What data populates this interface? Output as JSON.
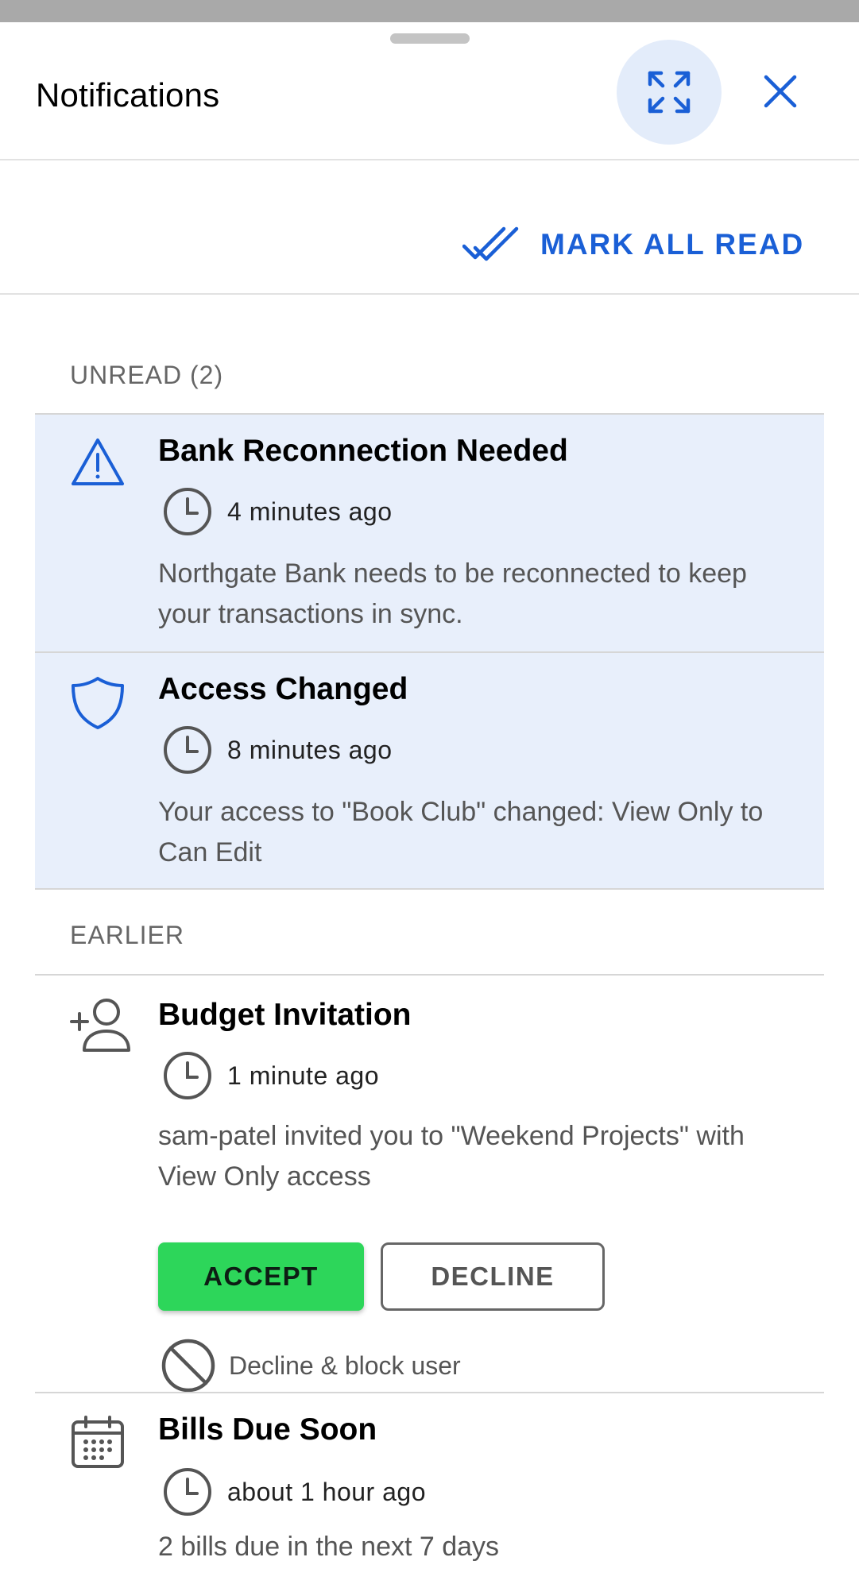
{
  "header": {
    "title": "Notifications",
    "expand_icon": "expand-arrows-icon",
    "close_icon": "close-icon"
  },
  "toolbar": {
    "mark_all_read_label": "MARK ALL READ",
    "mark_all_read_icon": "double-check-icon"
  },
  "sections": {
    "unread_label": "UNREAD (2)",
    "earlier_label": "EARLIER"
  },
  "notifications": [
    {
      "icon": "warning-icon",
      "title": "Bank Reconnection Needed",
      "time": "4 minutes ago",
      "body": "Northgate Bank needs to be reconnected to keep your transactions in sync.",
      "unread": true
    },
    {
      "icon": "shield-icon",
      "title": "Access Changed",
      "time": "8 minutes ago",
      "body": "Your access to \"Book Club\" changed: View Only to Can Edit",
      "unread": true
    },
    {
      "icon": "add-user-icon",
      "title": "Budget Invitation",
      "time": "1 minute ago",
      "body": "sam-patel invited you to \"Weekend Projects\" with View Only access",
      "unread": false,
      "actions": {
        "accept_label": "ACCEPT",
        "decline_label": "DECLINE",
        "block_label": "Decline & block user"
      }
    },
    {
      "icon": "calendar-icon",
      "title": "Bills Due Soon",
      "time": "about 1 hour ago",
      "body": "2 bills due in the next 7 days",
      "unread": false
    }
  ],
  "colors": {
    "accent": "#1a5fd6",
    "unread_bg": "#e8effb",
    "accept_green": "#2dd65a",
    "expand_bg": "#e3ecfa"
  }
}
